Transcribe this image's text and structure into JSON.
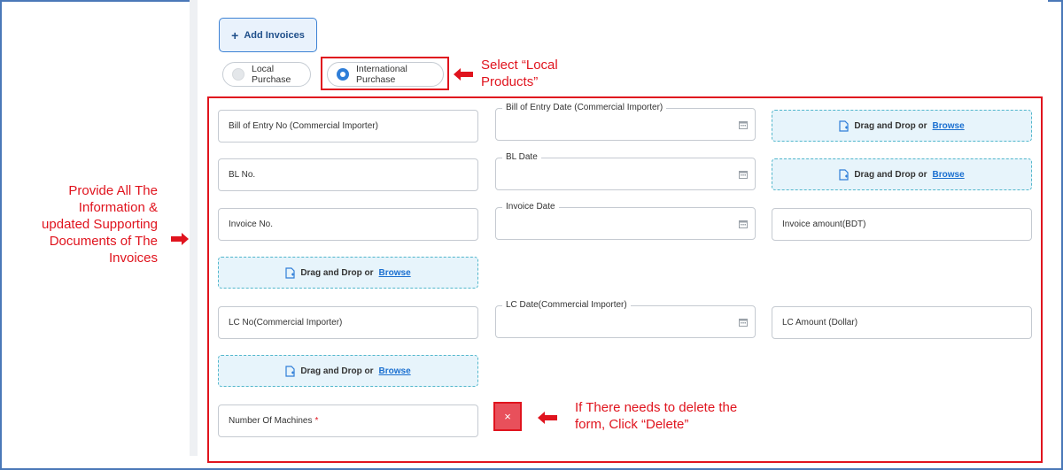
{
  "header": {
    "add_invoices_label": "Add Invoices"
  },
  "purchase_type": {
    "options": [
      "Local Purchase",
      "International Purchase"
    ],
    "selected": "International Purchase"
  },
  "form": {
    "bill_of_entry_no": {
      "placeholder": "Bill of Entry No (Commercial Importer)"
    },
    "bill_of_entry_date": {
      "label": "Bill of Entry Date (Commercial Importer)"
    },
    "bl_no": {
      "placeholder": "BL No."
    },
    "bl_date": {
      "label": "BL Date"
    },
    "invoice_no": {
      "placeholder": "Invoice No."
    },
    "invoice_date": {
      "label": "Invoice Date"
    },
    "invoice_amount": {
      "placeholder": "Invoice amount(BDT)"
    },
    "lc_no": {
      "placeholder": "LC No(Commercial Importer)"
    },
    "lc_date": {
      "label": "LC Date(Commercial Importer)"
    },
    "lc_amount": {
      "placeholder": "LC Amount (Dollar)"
    },
    "number_of_machines": {
      "placeholder": "Number Of Machines",
      "required_mark": "*"
    },
    "dropzone": {
      "text": "Drag and Drop or",
      "link": "Browse"
    },
    "delete_label": "×"
  },
  "annotations": {
    "select": [
      "Select “Local",
      "Products”"
    ],
    "provide": [
      "Provide All The",
      "Information &",
      "updated Supporting",
      "Documents of The",
      "Invoices"
    ],
    "delete": [
      "If There needs to delete the",
      "form, Click “Delete”"
    ]
  },
  "colors": {
    "annotation_red": "#e0141e",
    "primary_blue": "#2f7ed8",
    "dropzone_bg": "#e7f4fb"
  }
}
